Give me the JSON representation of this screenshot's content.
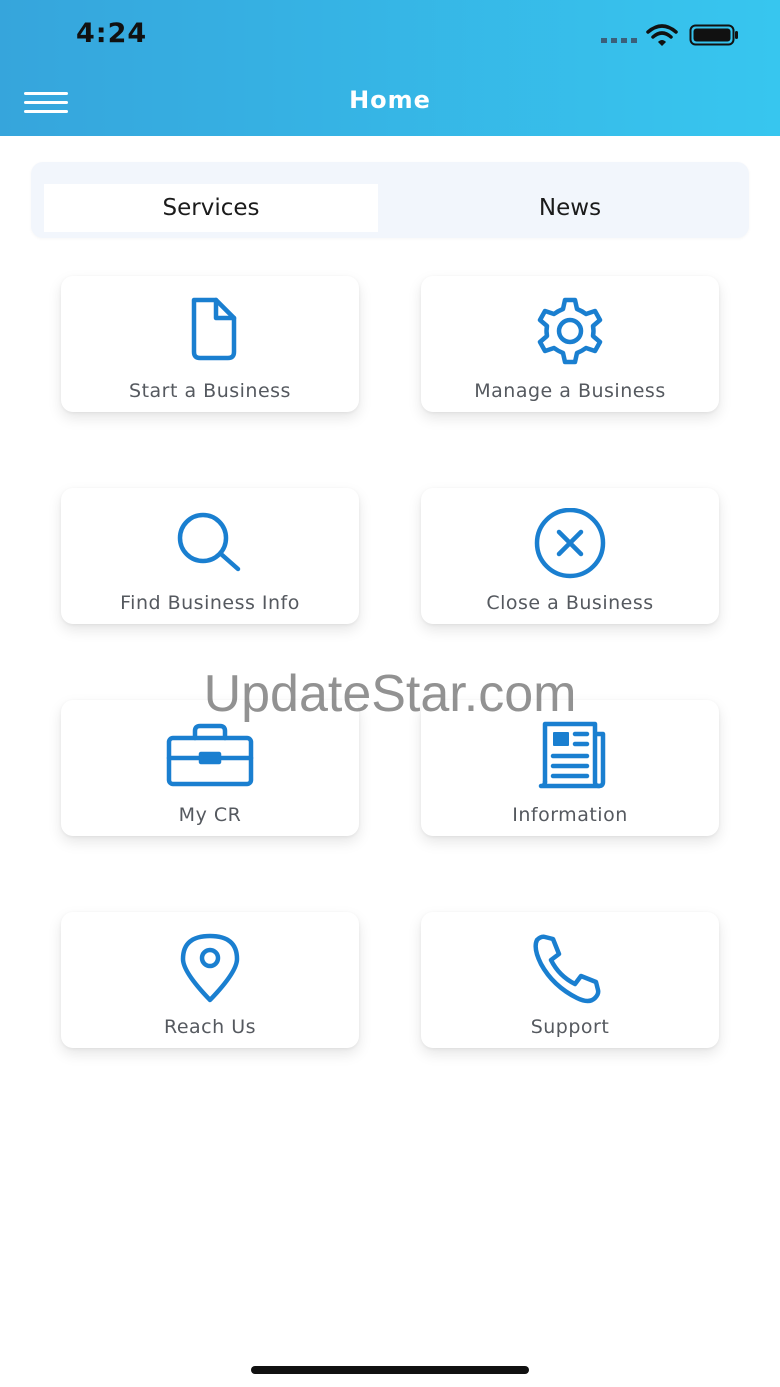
{
  "status_bar": {
    "time": "4:24"
  },
  "header": {
    "title": "Home"
  },
  "tabs": [
    {
      "label": "Services",
      "active": true
    },
    {
      "label": "News",
      "active": false
    }
  ],
  "tiles": [
    {
      "label": "Start a Business",
      "icon": "document-icon"
    },
    {
      "label": "Manage a Business",
      "icon": "gear-icon"
    },
    {
      "label": "Find Business Info",
      "icon": "search-icon"
    },
    {
      "label": "Close a Business",
      "icon": "close-circle-icon"
    },
    {
      "label": "My CR",
      "icon": "briefcase-icon"
    },
    {
      "label": "Information",
      "icon": "newspaper-icon"
    },
    {
      "label": "Reach Us",
      "icon": "location-pin-icon"
    },
    {
      "label": "Support",
      "icon": "phone-icon"
    }
  ],
  "watermark": "UpdateStar.com",
  "colors": {
    "accent": "#1a7fd0",
    "header_start": "#36a5dc",
    "header_end": "#37c6ef"
  }
}
